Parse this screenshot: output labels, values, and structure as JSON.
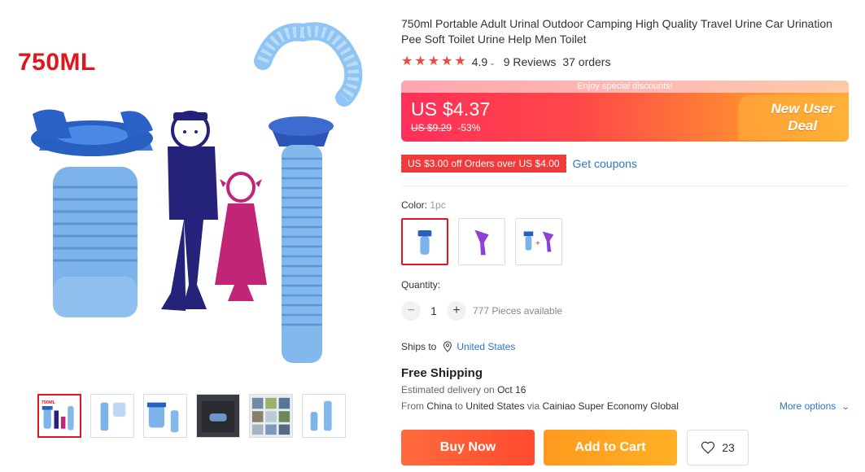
{
  "product": {
    "image_label": "750ML",
    "title": "750ml Portable Adult Urinal Outdoor Camping High Quality Travel Urine Car Urination Pee Soft Toilet Urine Help Men Toilet",
    "rating": "4.9",
    "reviews": "9 Reviews",
    "orders": "37 orders"
  },
  "price": {
    "discount_strip": "Enjoy special discounts!",
    "current": "US $4.37",
    "original": "US $9.29",
    "discount": "-53%",
    "badge_line1": "New User",
    "badge_line2": "Deal"
  },
  "coupon": {
    "text": "US $3.00 off Orders over US $4.00",
    "link": "Get coupons"
  },
  "color": {
    "label": "Color:",
    "value": "1pc"
  },
  "quantity": {
    "label": "Quantity:",
    "minus": "−",
    "plus": "+",
    "value": "1",
    "available": "777 Pieces available"
  },
  "shipping": {
    "ships_to_label": "Ships to",
    "country": "United States",
    "free_shipping": "Free Shipping",
    "delivery_prefix": "Estimated delivery on",
    "delivery_date": "Oct 16",
    "from_prefix": "From",
    "from_country": "China",
    "to_word": "to",
    "to_country": "United States",
    "via_word": "via",
    "carrier": "Cainiao Super Economy Global",
    "more_options": "More options"
  },
  "actions": {
    "buy_now": "Buy Now",
    "add_to_cart": "Add to Cart",
    "wishlist_count": "23"
  },
  "colors": {
    "accent_red": "#e0161d",
    "link_blue": "#2d76c7",
    "buy_now": "#ff5533",
    "add_to_cart": "#ffa522"
  }
}
